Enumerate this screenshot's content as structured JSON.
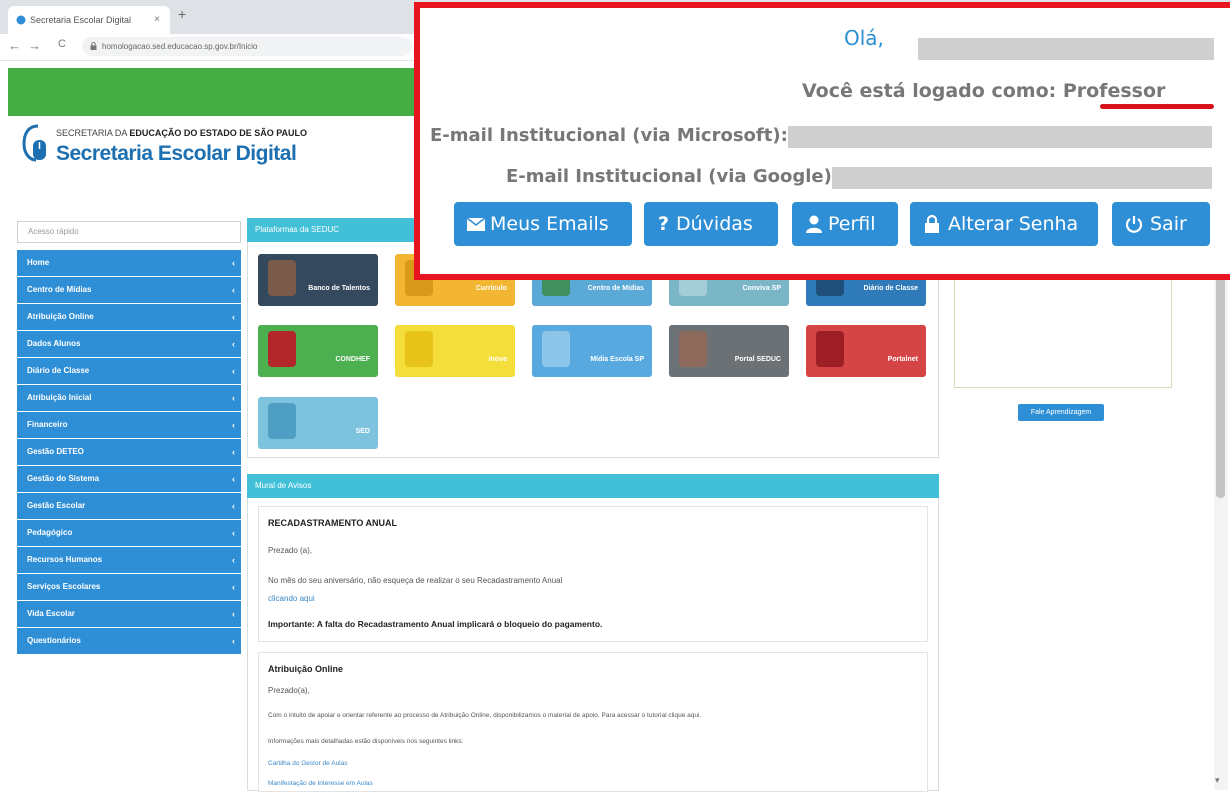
{
  "browser": {
    "tab_title": "Secretaria Escolar Digital",
    "tab_close": "×",
    "new_tab": "+",
    "back": "←",
    "forward": "→",
    "reload": "C",
    "url": "homologacao.sed.educacao.sp.gov.br/Inicio"
  },
  "header": {
    "org_prefix": "SECRETARIA DA ",
    "org_bold": "EDUCAÇÃO DO ESTADO DE SÃO PAULO",
    "brand": "Secretaria Escolar Digital"
  },
  "overlay": {
    "greeting": "Olá,",
    "logged_as": "Você está logado como: Professor",
    "email_microsoft_label": "E-mail Institucional (via Microsoft):",
    "email_google_label": "E-mail Institucional (via Google):",
    "buttons": {
      "emails": "Meus Emails",
      "help": "Dúvidas",
      "profile": "Perfil",
      "password": "Alterar Senha",
      "logout": "Sair"
    }
  },
  "sidebar": {
    "search_placeholder": "Acesso rápido",
    "items": [
      {
        "label": "Home"
      },
      {
        "label": "Centro de Mídias"
      },
      {
        "label": "Atribuição Online"
      },
      {
        "label": "Dados Alunos"
      },
      {
        "label": "Diário de Classe"
      },
      {
        "label": "Atribuição Inicial"
      },
      {
        "label": "Financeiro"
      },
      {
        "label": "Gestão DETEO"
      },
      {
        "label": "Gestão do Sistema"
      },
      {
        "label": "Gestão Escolar"
      },
      {
        "label": "Pedagógico"
      },
      {
        "label": "Recursos Humanos"
      },
      {
        "label": "Serviços Escolares"
      },
      {
        "label": "Vida Escolar"
      },
      {
        "label": "Questionários"
      }
    ]
  },
  "platforms": {
    "title": "Plataformas da SEDUC",
    "tiles": [
      {
        "label": "Banco de Talentos",
        "color": "#34495e"
      },
      {
        "label": "Currículo",
        "color": "#f2b632"
      },
      {
        "label": "Centro de Mídias",
        "color": "#5aa9d6"
      },
      {
        "label": "Conviva SP",
        "color": "#7bb6c7"
      },
      {
        "label": "Diário de Classe",
        "color": "#2f7ab8"
      },
      {
        "label": "CONDHEF",
        "color": "#4caf50"
      },
      {
        "label": "Inova",
        "color": "#f3de3a"
      },
      {
        "label": "Mídia Escola SP",
        "color": "#57a9e0"
      },
      {
        "label": "Portal SEDUC",
        "color": "#6b7175"
      },
      {
        "label": "Portalnet",
        "color": "#d64545"
      },
      {
        "label": "SED",
        "color": "#7ec3de"
      }
    ]
  },
  "right": {
    "button": "Fale Aprendizagem"
  },
  "notices": {
    "title": "Mural de Avisos",
    "card1": {
      "title": "RECADASTRAMENTO ANUAL",
      "greeting": "Prezado (a),",
      "body": "No mês do seu aniversário, não esqueça de realizar o seu Recadastramento Anual",
      "link": "clicando aqui",
      "important": "Importante: A falta do Recadastramento Anual implicará o bloqueio do pagamento."
    },
    "card2": {
      "title": "Atribuição Online",
      "greeting": "Prezado(a),",
      "body": "Com o intuito de apoiar e orientar referente ao processo de Atribuição Online, disponibilizamos o material de apoio. Para acessar o tutorial clique aqui.",
      "info": "Informações mais detalhadas estão disponíveis nos seguintes links:",
      "link1": "Cartilha do Gestor de Aulas",
      "link2": "Manifestação de Interesse em Aulas"
    }
  }
}
